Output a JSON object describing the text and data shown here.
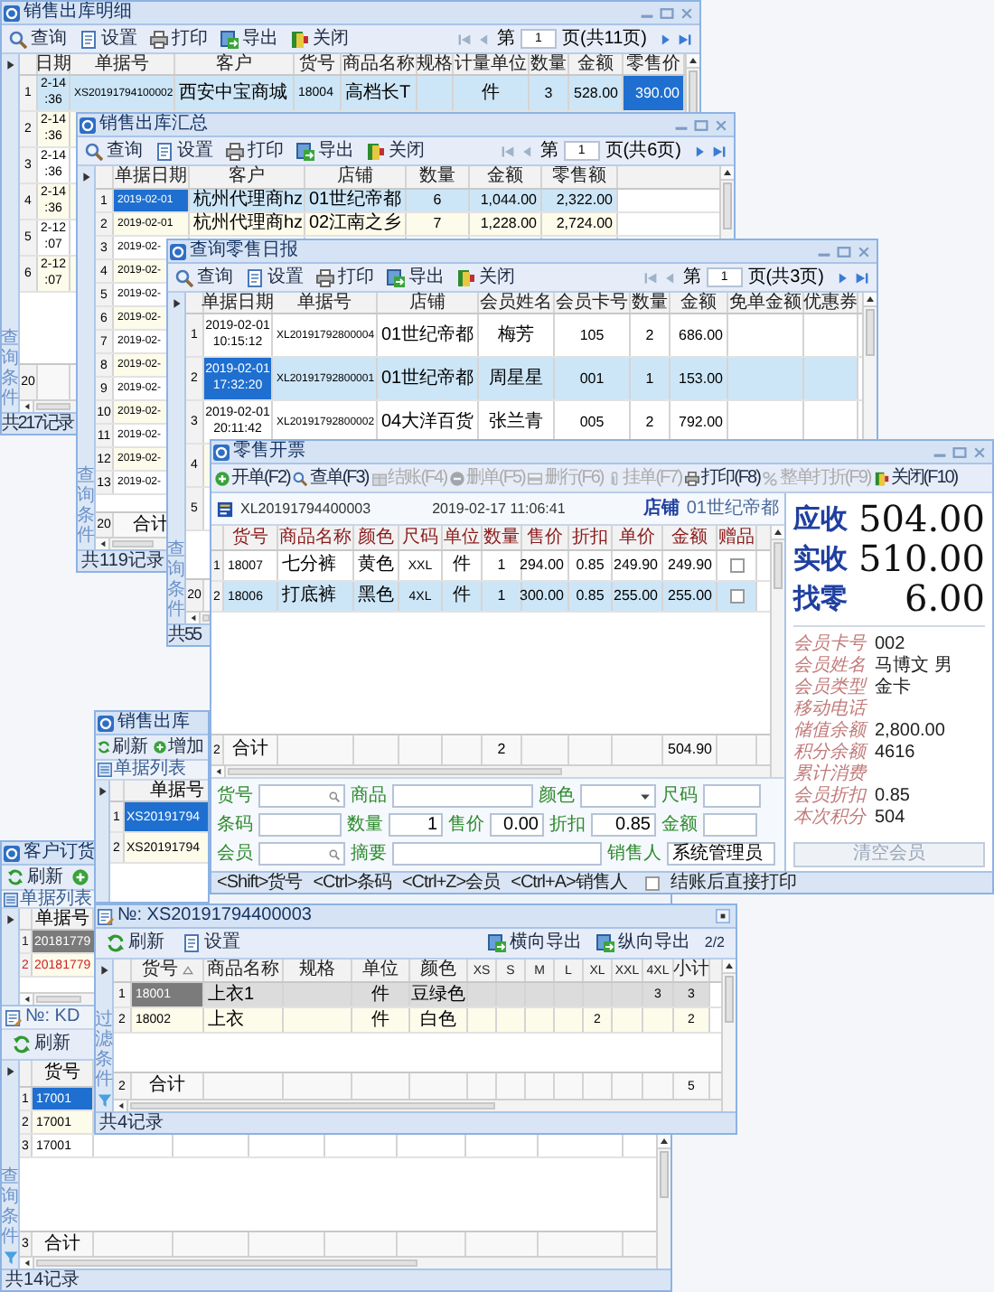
{
  "windows": [
    {
      "kind": "grid",
      "title": "销售出库明细",
      "grid_focused": true,
      "side_label": "查询条件",
      "toolbar": [
        {
          "kind": "query",
          "label": "查询"
        },
        {
          "kind": "settings",
          "label": "设置"
        },
        {
          "kind": "print",
          "label": "打印"
        },
        {
          "kind": "export",
          "label": "导出"
        },
        {
          "kind": "close",
          "label": "关闭"
        }
      ],
      "pager": {
        "prefix": "第",
        "page": "1",
        "suffix": "页(共11页)"
      },
      "columns": [
        "日期",
        "单据号",
        "客户",
        "货号",
        "商品名称",
        "规格",
        "计量单位",
        "数量",
        "金额",
        "零售价"
      ],
      "rows": [
        {
          "number": "1",
          "selected": true,
          "cells": [
            "2-14 :36",
            "XS20191794100002",
            "西安中宝商城",
            "18004",
            "高档长T",
            null,
            "件",
            "3",
            "528.00",
            {
              "text": "390.00",
              "focused": true
            }
          ]
        },
        {
          "number": "2",
          "selected": false,
          "cells": [
            "2-14 :36"
          ]
        },
        {
          "number": "3",
          "selected": false,
          "cells": [
            "2-14 :36"
          ]
        },
        {
          "number": "4",
          "selected": false,
          "cells": [
            "2-14 :36"
          ]
        },
        {
          "number": "5",
          "selected": false,
          "cells": [
            "2-12 :07"
          ]
        },
        {
          "number": "6",
          "selected": false,
          "cells": [
            "2-12 :07"
          ]
        }
      ],
      "total": {
        "number": "20"
      },
      "status": "共217记录"
    },
    {
      "kind": "grid",
      "title": "销售出库汇总",
      "grid_focused": true,
      "side_label": "查询条件",
      "toolbar": [
        {
          "kind": "query",
          "label": "查询"
        },
        {
          "kind": "settings",
          "label": "设置"
        },
        {
          "kind": "print",
          "label": "打印"
        },
        {
          "kind": "export",
          "label": "导出"
        },
        {
          "kind": "close",
          "label": "关闭"
        }
      ],
      "pager": {
        "prefix": "第",
        "page": "1",
        "suffix": "页(共6页)"
      },
      "columns": [
        "单据日期",
        "客户",
        "店铺",
        "数量",
        "金额",
        "零售额"
      ],
      "rows": [
        {
          "number": "1",
          "selected": true,
          "cells": [
            {
              "text": "2019-02-01",
              "focused": true
            },
            "杭州代理商hz",
            "01世纪帝都",
            "6",
            "1,044.00",
            "2,322.00"
          ]
        },
        {
          "number": "2",
          "selected": false,
          "cells": [
            "2019-02-01",
            "杭州代理商hz",
            "02江南之乡",
            "7",
            "1,228.00",
            "2,724.00"
          ]
        },
        {
          "number": "3",
          "selected": false,
          "cells": [
            "2019-02-"
          ]
        },
        {
          "number": "4",
          "selected": false,
          "cells": [
            "2019-02-"
          ]
        },
        {
          "number": "5",
          "selected": false,
          "cells": [
            "2019-02-"
          ]
        },
        {
          "number": "6",
          "selected": false,
          "cells": [
            "2019-02-"
          ]
        },
        {
          "number": "7",
          "selected": false,
          "cells": [
            "2019-02-"
          ]
        },
        {
          "number": "8",
          "selected": false,
          "cells": [
            "2019-02-"
          ]
        },
        {
          "number": "9",
          "selected": false,
          "cells": [
            "2019-02-"
          ]
        },
        {
          "number": "10",
          "selected": false,
          "cells": [
            "2019-02-"
          ]
        },
        {
          "number": "11",
          "selected": false,
          "cells": [
            "2019-02-"
          ]
        },
        {
          "number": "12",
          "selected": false,
          "cells": [
            "2019-02-"
          ]
        },
        {
          "number": "13",
          "selected": false,
          "cells": [
            "2019-02-"
          ]
        }
      ],
      "total": {
        "number": "20",
        "cells": [
          "合计"
        ]
      },
      "status": "共119记录"
    },
    {
      "kind": "grid",
      "title": "查询零售日报",
      "grid_focused": true,
      "side_label": "查询条件",
      "toolbar": [
        {
          "kind": "query",
          "label": "查询"
        },
        {
          "kind": "settings",
          "label": "设置"
        },
        {
          "kind": "print",
          "label": "打印"
        },
        {
          "kind": "export",
          "label": "导出"
        },
        {
          "kind": "close",
          "label": "关闭"
        }
      ],
      "pager": {
        "prefix": "第",
        "page": "1",
        "suffix": "页(共3页)"
      },
      "columns": [
        "单据日期",
        "单据号",
        "店铺",
        "会员姓名",
        "会员卡号",
        "数量",
        "金额",
        "免单金额",
        "优惠券"
      ],
      "rows": [
        {
          "number": "1",
          "selected": false,
          "cells": [
            "2019-02-01 10:15:12",
            "XL20191792800004",
            "01世纪帝都",
            "梅芳",
            "105",
            "2",
            "686.00"
          ]
        },
        {
          "number": "2",
          "selected": true,
          "cells": [
            {
              "text": "2019-02-01 17:32:20",
              "focused": true
            },
            "XL20191792800001",
            "01世纪帝都",
            "周星星",
            "001",
            "1",
            "153.00"
          ]
        },
        {
          "number": "3",
          "selected": false,
          "cells": [
            "2019-02-01 20:11:42",
            "XL20191792800002",
            "04大洋百货",
            "张兰青",
            "005",
            "2",
            "792.00"
          ]
        },
        {
          "number": "4",
          "cells": []
        },
        {
          "number": "5",
          "cells": []
        }
      ],
      "total": {
        "number": "20"
      },
      "status": "共55"
    },
    {
      "kind": "orders",
      "title": "客户订货",
      "grid_focused": false,
      "toolbar": [
        {
          "kind": "refresh",
          "label": "刷新"
        },
        {
          "kind": "add"
        }
      ],
      "panel_title": "单据列表",
      "columns": [
        "单据号"
      ],
      "rows": [
        {
          "number": "1",
          "alert": false,
          "cells": [
            {
              "text": "20181779",
              "focused": true
            }
          ]
        },
        {
          "number": "2",
          "alert": true,
          "cells": [
            "20181779"
          ]
        }
      ],
      "detail": {
        "title": "№: KD",
        "grid_focused": true,
        "toolbar": [
          {
            "kind": "refresh",
            "label": "刷新"
          }
        ],
        "side_label": "查询条件",
        "columns": [
          "货号"
        ],
        "rows": [
          {
            "number": "1",
            "cells": [
              {
                "text": "17001",
                "focused": true
              }
            ]
          },
          {
            "number": "2",
            "selected": false,
            "cells": [
              "17001"
            ]
          },
          {
            "number": "3",
            "selected": false,
            "cells": [
              "17001"
            ]
          }
        ],
        "total": {
          "number": "3",
          "cells": [
            "合计"
          ]
        },
        "status": "共14记录"
      }
    },
    {
      "kind": "list",
      "title": "销售出库",
      "grid_focused": true,
      "toolbar": [
        {
          "kind": "refresh",
          "label": "刷新"
        },
        {
          "kind": "add",
          "label": "增加"
        }
      ],
      "panel_title": "单据列表",
      "columns": [
        "单据号"
      ],
      "rows": [
        {
          "number": "1",
          "cells": [
            {
              "text": "XS20191794",
              "focused": true
            }
          ]
        },
        {
          "number": "2",
          "selected": false,
          "cells": [
            "XS20191794"
          ]
        }
      ]
    },
    {
      "kind": "pos",
      "title": "零售开票",
      "toolbar": [
        {
          "kind": "new",
          "label": "开单(F2)",
          "disabled": false
        },
        {
          "kind": "find",
          "label": "查单(F3)",
          "disabled": false
        },
        {
          "kind": "checkout",
          "label": "结账(F4)",
          "disabled": true
        },
        {
          "kind": "delete",
          "label": "删单(F5)",
          "disabled": true
        },
        {
          "kind": "delete_row",
          "label": "删行(F6)",
          "disabled": true
        },
        {
          "kind": "hold",
          "label": "挂单(F7)",
          "disabled": true
        },
        {
          "kind": "print",
          "label": "打印(F8)",
          "disabled": false
        },
        {
          "kind": "discount",
          "label": "整单打折(F9)",
          "disabled": true
        },
        {
          "kind": "close",
          "label": "关闭(F10)",
          "disabled": false
        }
      ],
      "ticket": {
        "number": "XL20191794400003",
        "datetime": "2019-02-17 11:06:41",
        "store_label": "店铺",
        "store": "01世纪帝都"
      },
      "columns": [
        "货号",
        "商品名称",
        "颜色",
        "尺码",
        "单位",
        "数量",
        "售价",
        "折扣",
        "单价",
        "金额",
        "赠品"
      ],
      "rows": [
        {
          "number": "1",
          "selected": false,
          "gift": false,
          "cells": [
            "18007",
            "七分裤",
            "黄色",
            "XXL",
            "件",
            "1",
            "294.00",
            "0.85",
            "249.90",
            "249.90"
          ]
        },
        {
          "number": "2",
          "selected": true,
          "gift": false,
          "cells": [
            "18006",
            "打底裤",
            "黑色",
            "4XL",
            "件",
            "1",
            "300.00",
            "0.85",
            "255.00",
            "255.00"
          ]
        }
      ],
      "total": {
        "number": "2",
        "label": "合计",
        "quantity": "2",
        "amount": "504.90"
      },
      "totals": [
        {
          "label": "应收",
          "value": "504.00"
        },
        {
          "label": "实收",
          "value": "510.00"
        },
        {
          "label": "找零",
          "value": "6.00"
        }
      ],
      "member": [
        {
          "label": "会员卡号",
          "value": "002"
        },
        {
          "label": "会员姓名",
          "value": "马博文 男"
        },
        {
          "label": "会员类型",
          "value": "金卡"
        },
        {
          "label": "移动电话"
        },
        {
          "label": "储值余额",
          "value": "2,800.00"
        },
        {
          "label": "积分余额",
          "value": "4616"
        },
        {
          "label": "累计消费"
        },
        {
          "label": "会员折扣",
          "value": "0.85"
        },
        {
          "label": "本次积分",
          "value": "504"
        }
      ],
      "clear_member_button": "清空会员",
      "form": [
        {
          "label": "货号",
          "kind": "search"
        },
        {
          "label": "商品",
          "kind": "text"
        },
        {
          "label": "颜色",
          "kind": "dropdown"
        },
        {
          "label": "尺码",
          "kind": "text"
        },
        {
          "label": "条码",
          "kind": "text"
        },
        {
          "label": "数量",
          "kind": "number",
          "value": "1"
        },
        {
          "label": "售价",
          "kind": "number",
          "value": "0.00"
        },
        {
          "label": "折扣",
          "kind": "number",
          "value": "0.85"
        },
        {
          "label": "金额",
          "kind": "text"
        },
        {
          "label": "会员",
          "kind": "search"
        },
        {
          "label": "摘要",
          "kind": "text"
        },
        {
          "label": "销售人",
          "kind": "text",
          "value": "系统管理员"
        }
      ],
      "hints": [
        "<Shift>货号",
        "<Ctrl>条码",
        "<Ctrl+Z>会员",
        "<Ctrl+A>销售人"
      ],
      "print_after_checkout": {
        "label": "结账后直接打印",
        "checked": false
      }
    },
    {
      "kind": "grid",
      "title": "№: XS20191794400003",
      "grid_focused": false,
      "side_label": "过滤条件",
      "sorted_ascending": true,
      "toolbar": [
        {
          "kind": "refresh",
          "label": "刷新"
        },
        {
          "kind": "settings",
          "label": "设置"
        }
      ],
      "toolbar_right": [
        {
          "kind": "export",
          "label": "横向导出"
        },
        {
          "kind": "export",
          "label": "纵向导出"
        }
      ],
      "page_info": "2/2",
      "columns": [
        "货号",
        "商品名称",
        "规格",
        "单位",
        "颜色",
        "XS",
        "S",
        "M",
        "L",
        "XL",
        "XXL",
        "4XL",
        "小计"
      ],
      "rows": [
        {
          "number": "1",
          "selected": true,
          "cells": [
            {
              "text": "18001",
              "focused": true
            },
            "上衣1",
            null,
            "件",
            "豆绿色",
            null,
            null,
            null,
            null,
            null,
            null,
            "3",
            "3"
          ]
        },
        {
          "number": "2",
          "selected": false,
          "cells": [
            "18002",
            "上衣",
            null,
            "件",
            "白色",
            null,
            null,
            null,
            null,
            "2",
            null,
            null,
            "2"
          ]
        }
      ],
      "total": {
        "number": "2",
        "cells": [
          "合计",
          null,
          null,
          null,
          null,
          null,
          null,
          null,
          null,
          null,
          null,
          null,
          "5"
        ]
      },
      "status": "共4记录"
    }
  ]
}
